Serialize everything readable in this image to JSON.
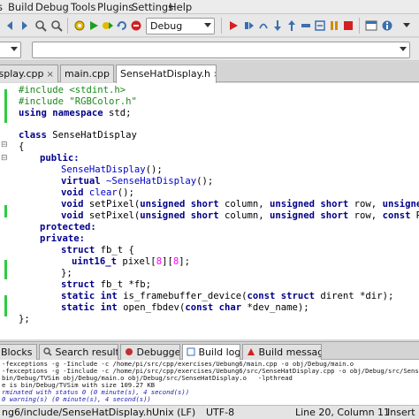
{
  "menubar": {
    "items": [
      "s",
      "Build",
      "Debug",
      "Tools",
      "Plugins",
      "Settings",
      "Help"
    ]
  },
  "toolbar": {
    "build_target": "Debug"
  },
  "tabs": [
    {
      "label": "Display.cpp",
      "active": false
    },
    {
      "label": "main.cpp",
      "active": false
    },
    {
      "label": "SenseHatDisplay.h",
      "active": true
    }
  ],
  "tab_close": "×",
  "fold_symbol": "⊟",
  "code": {
    "line1_pp": "#include <stdint.h>",
    "line2_pp": "#include \"RGBColor.h\"",
    "line3_kw": "using namespace",
    "line3_rest": " std;",
    "line5_kw": "class",
    "line5_rest": " SenseHatDisplay",
    "line6": "{",
    "line7_kw": "public:",
    "line8_fn": "SenseHatDisplay",
    "line8_rest": "();",
    "line9_kw": "virtual",
    "line9_fn": " ~SenseHatDisplay",
    "line9_rest": "();",
    "line10_kw": "void",
    "line10_fn": " clear",
    "line10_rest": "();",
    "line11_kw": "void",
    "line11_rest": " setPixel(",
    "line11_kw2": "unsigned short",
    "line11_rest2": " column, ",
    "line11_kw3": "unsigned short",
    "line11_rest3": " row, ",
    "line11_kw4": "unsigned in",
    "line12_kw": "void",
    "line12_rest": " setPixel(",
    "line12_kw2": "unsigned short",
    "line12_rest2": " column, ",
    "line12_kw3": "unsigned short",
    "line12_rest3": " row, ",
    "line12_kw4": "const",
    "line12_rest4": " RGBCo",
    "line13_kw": "protected:",
    "line14_kw": "private:",
    "line15_kw": "struct",
    "line15_rest": " fb_t {",
    "line16_ty": "uint16_t",
    "line16_rest": " pixel[",
    "line16_n1": "8",
    "line16_mid": "][",
    "line16_n2": "8",
    "line16_end": "];",
    "line17": "};",
    "line18_kw": "struct",
    "line18_rest": " fb_t *fb;",
    "line19_kw": "static int",
    "line19_rest": " is_framebuffer_device(",
    "line19_kw2": "const struct",
    "line19_rest2": " dirent *dir);",
    "line20_kw": "static int",
    "line20_rest": " open_fbdev(",
    "line20_kw2": "const char",
    "line20_rest2": " *dev_name);",
    "line21": "};"
  },
  "lower_tabs": [
    {
      "label": "Blocks",
      "icon": "blocks-icon"
    },
    {
      "label": "Search results",
      "icon": "search-icon"
    },
    {
      "label": "Debugger",
      "icon": "debugger-icon"
    },
    {
      "label": "Build log",
      "icon": "build-log-icon",
      "active": true
    },
    {
      "label": "Build messages",
      "icon": "build-messages-icon"
    }
  ],
  "build_log": [
    "-fexceptions -g -Iinclude -c /home/pi/src/cpp/exercises/Uebung6/main.cpp -o obj/Debug/main.o",
    "-fexceptions -g -Iinclude -c /home/pi/src/cpp/exercises/Uebung6/src/SenseHatDisplay.cpp -o obj/Debug/src/SenseHatDisplay.",
    "bin/Debug/TVSim obj/Debug/main.o obj/Debug/src/SenseHatDisplay.o   -lpthread",
    "e is bin/Debug/TVSim with size 109.27 KB",
    "rminated with status 0 (0 minute(s), 4 second(s))",
    "0 warning(s) (0 minute(s), 4 second(s))"
  ],
  "status": {
    "path": "ng6/include/SenseHatDisplay.h",
    "eol": "Unix (LF)",
    "encoding": "UTF-8",
    "position": "Line 20, Column 11",
    "mode": "Insert"
  }
}
